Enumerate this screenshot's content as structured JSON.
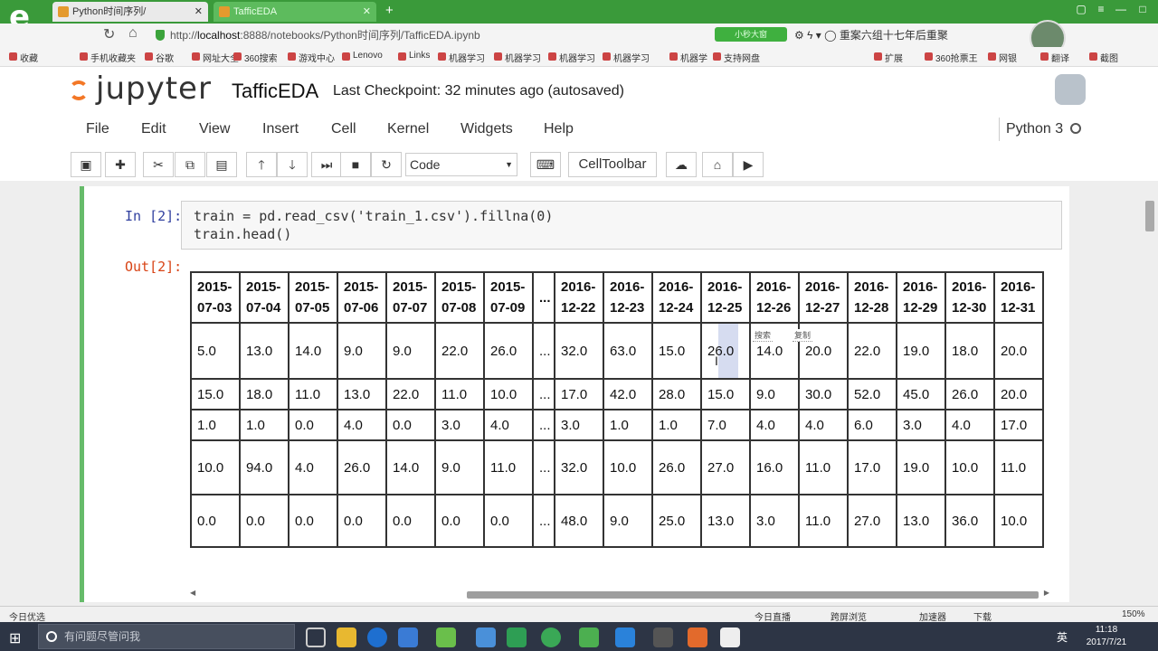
{
  "browser": {
    "tabs": [
      {
        "label": "Python时间序列/",
        "active": false
      },
      {
        "label": "TafficEDA",
        "active": true
      }
    ],
    "url_prefix": "http://",
    "url_host": "localhost",
    "url_path": ":8888/notebooks/Python时间序列/TafficEDA.ipynb",
    "badge": "小秒大窗",
    "addr_right": "⚙ ϟ ▾  ◯ 重案六组十七年后重聚",
    "bookmarks": [
      "收藏",
      "手机收藏夹",
      "谷歌",
      "网址大全",
      "360搜索",
      "游戏中心",
      "Lenovo",
      "Links",
      "机器学习",
      "机器学习",
      "机器学习",
      "机器学习",
      "机器学",
      "支持网盘",
      "扩展",
      "360抢票王",
      "网银",
      "翻译",
      "截图"
    ]
  },
  "jupyter": {
    "logo_text": "jupyter",
    "notebook_name": "TafficEDA",
    "checkpoint": "Last Checkpoint: 32 minutes ago (autosaved)",
    "menu": [
      "File",
      "Edit",
      "View",
      "Insert",
      "Cell",
      "Kernel",
      "Widgets",
      "Help"
    ],
    "kernel": "Python 3",
    "toolbar_icons": [
      "save-icon",
      "add-cell-icon",
      "cut-icon",
      "copy-icon",
      "paste-icon",
      "move-up-icon",
      "move-down-icon",
      "run-next-icon",
      "stop-icon",
      "restart-icon"
    ],
    "cell_type": "Code",
    "cell_toolbar_label": "CellToolbar"
  },
  "cell": {
    "in_prompt": "In [2]:",
    "code_line1": "train = pd.read_csv('train_1.csv').fillna(0)",
    "code_line2": "train.head()",
    "out_prompt": "Out[2]:"
  },
  "table": {
    "columns": [
      [
        "2015-",
        "07-03"
      ],
      [
        "2015-",
        "07-04"
      ],
      [
        "2015-",
        "07-05"
      ],
      [
        "2015-",
        "07-06"
      ],
      [
        "2015-",
        "07-07"
      ],
      [
        "2015-",
        "07-08"
      ],
      [
        "2015-",
        "07-09"
      ],
      [
        "...",
        ""
      ],
      [
        "2016-",
        "12-22"
      ],
      [
        "2016-",
        "12-23"
      ],
      [
        "2016-",
        "12-24"
      ],
      [
        "2016-",
        "12-25"
      ],
      [
        "2016-",
        "12-26"
      ],
      [
        "2016-",
        "12-27"
      ],
      [
        "2016-",
        "12-28"
      ],
      [
        "2016-",
        "12-29"
      ],
      [
        "2016-",
        "12-30"
      ],
      [
        "2016-",
        "12-31"
      ]
    ],
    "rows": [
      [
        "5.0",
        "13.0",
        "14.0",
        "9.0",
        "9.0",
        "22.0",
        "26.0",
        "...",
        "32.0",
        "63.0",
        "15.0",
        "26.0",
        "14.0",
        "20.0",
        "22.0",
        "19.0",
        "18.0",
        "20.0"
      ],
      [
        "15.0",
        "18.0",
        "11.0",
        "13.0",
        "22.0",
        "11.0",
        "10.0",
        "...",
        "17.0",
        "42.0",
        "28.0",
        "15.0",
        "9.0",
        "30.0",
        "52.0",
        "45.0",
        "26.0",
        "20.0"
      ],
      [
        "1.0",
        "1.0",
        "0.0",
        "4.0",
        "0.0",
        "3.0",
        "4.0",
        "...",
        "3.0",
        "1.0",
        "1.0",
        "7.0",
        "4.0",
        "4.0",
        "6.0",
        "3.0",
        "4.0",
        "17.0"
      ],
      [
        "10.0",
        "94.0",
        "4.0",
        "26.0",
        "14.0",
        "9.0",
        "11.0",
        "...",
        "32.0",
        "10.0",
        "26.0",
        "27.0",
        "16.0",
        "11.0",
        "17.0",
        "19.0",
        "10.0",
        "11.0"
      ],
      [
        "0.0",
        "0.0",
        "0.0",
        "0.0",
        "0.0",
        "0.0",
        "0.0",
        "...",
        "48.0",
        "9.0",
        "25.0",
        "13.0",
        "3.0",
        "11.0",
        "27.0",
        "13.0",
        "36.0",
        "10.0"
      ]
    ],
    "context_hint_1": "搜索",
    "context_hint_2": "复制"
  },
  "statusbar": {
    "left": "今日优选",
    "items": [
      "今日直播",
      "跨屏浏览",
      "加速器",
      "下载"
    ],
    "zoom": "150%"
  },
  "taskbar": {
    "search_placeholder": "有问题尽管问我",
    "time": "11:18",
    "date": "2017/7/21",
    "ime": "英"
  },
  "colors": {
    "browser_green": "#3a9a3a",
    "jupyter_orange": "#f37726",
    "in_prompt": "#303f9f",
    "out_prompt": "#d84315",
    "selected_cell_bar": "#42a5f5"
  }
}
